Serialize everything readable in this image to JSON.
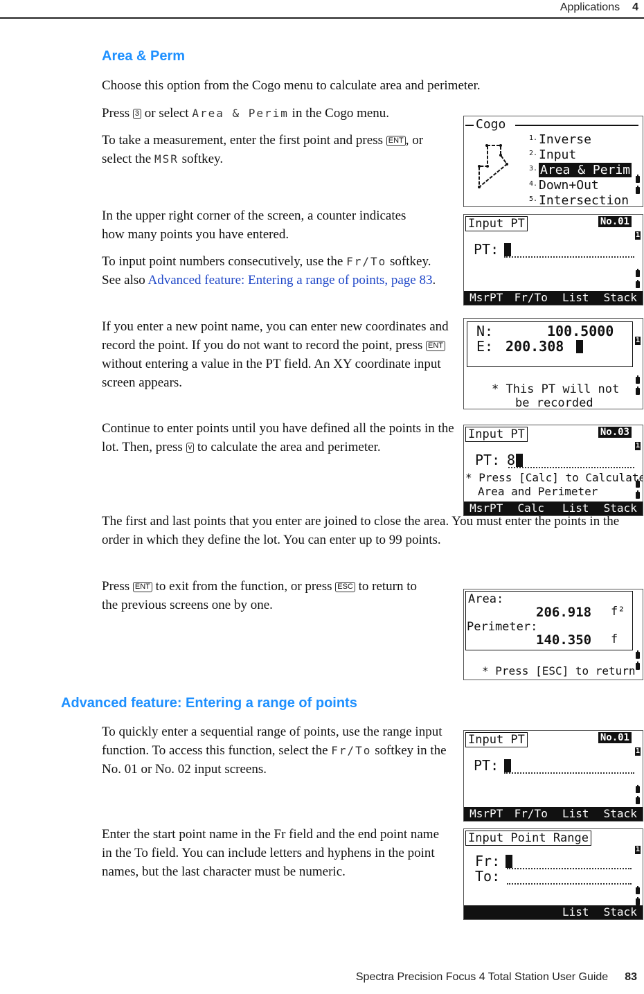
{
  "header": {
    "section": "Applications",
    "chapter": "4"
  },
  "footer": {
    "guide_title": "Spectra Precision Focus 4 Total Station User Guide",
    "page_number": "83"
  },
  "section1": {
    "title": "Area & Perm",
    "intro": "Choose this option from the Cogo menu to calculate area and perimeter.",
    "p1": {
      "a": "Press ",
      "key": "3",
      "b": " or select ",
      "lcd": "Area & Perim",
      "c": " in the Cogo menu."
    },
    "p2": {
      "a": "To take a measurement, enter the first point and press ",
      "key": "ENT",
      "b": ", or select the ",
      "lcd": "MSR",
      "c": " softkey."
    },
    "p3": "In the upper right corner of the screen, a counter indicates how many points you have entered.",
    "p4": {
      "a": "To input point numbers consecutively, use the ",
      "lcd": "Fr/To",
      "b": " softkey. See also ",
      "link": "Advanced feature: Entering a range of points, page 83",
      "c": "."
    },
    "p5": {
      "a": "If you enter a new point name, you can enter new coordinates and record the point. If you do not want to record the point, press ",
      "key": "ENT",
      "b": " without entering a value in the PT field. An XY coordinate input screen appears."
    },
    "p6": {
      "a": "Continue to enter points until you have defined all the points in the lot. Then, press ",
      "key": "v",
      "b": " to calculate the area and perimeter."
    },
    "p7": "The first and last points that you enter are joined to close the area. You must enter the points in the order in which they define the lot. You can enter up to 99 points.",
    "p8": {
      "a": "Press ",
      "key1": "ENT",
      "b": " to exit from the function, or press ",
      "key2": "ESC",
      "c": " to return to the previous screens one by one."
    }
  },
  "section2": {
    "title": "Advanced feature: Entering a range of points",
    "p1": {
      "a": "To quickly enter a sequential range of points, use the range input function. To access this function, select the ",
      "lcd": "Fr/To",
      "b": " softkey in the No. 01 or No. 02 input screens."
    },
    "p2": "Enter the start point name in the Fr field and the end point name in the To field. You can include letters and hyphens in the point names, but the last character must be numeric."
  },
  "screens": {
    "cogo": {
      "title": "Cogo",
      "items": [
        {
          "n": "1.",
          "label": "Inverse"
        },
        {
          "n": "2.",
          "label": "Input"
        },
        {
          "n": "3.",
          "label": "Area & Perim",
          "selected": true
        },
        {
          "n": "4.",
          "label": "Down+Out"
        },
        {
          "n": "5.",
          "label": "Intersection"
        }
      ]
    },
    "input1": {
      "title": "Input PT",
      "counter": "No.01",
      "field_label": "PT:",
      "field_value": "",
      "softkeys": [
        "MsrPT",
        "Fr/To",
        "List",
        "Stack"
      ],
      "badge": "1"
    },
    "coord": {
      "n_label": "N:",
      "n_value": "100.5000",
      "e_label": "E:",
      "e_value": "200.308",
      "note1": "* This PT will not",
      "note2": "be recorded",
      "badge": "1"
    },
    "input3": {
      "title": "Input PT",
      "counter": "No.03",
      "field_label": "PT:",
      "field_value": "8",
      "note1": "* Press [Calc] to Calculate",
      "note2": "Area and Perimeter",
      "softkeys": [
        "MsrPT",
        "Calc",
        "List",
        "Stack"
      ],
      "badge": "1"
    },
    "result": {
      "area_label": "Area:",
      "area_value": "206.918",
      "area_unit": "f²",
      "perim_label": "Perimeter:",
      "perim_value": "140.350",
      "perim_unit": "f",
      "note": "* Press [ESC] to return"
    },
    "input1b": {
      "title": "Input PT",
      "counter": "No.01",
      "field_label": "PT:",
      "field_value": "",
      "softkeys": [
        "MsrPT",
        "Fr/To",
        "List",
        "Stack"
      ],
      "badge": "1"
    },
    "range": {
      "title": "Input Point Range",
      "fr_label": "Fr:",
      "to_label": "To:",
      "softkeys": [
        "List",
        "Stack"
      ],
      "badge": "1"
    }
  }
}
